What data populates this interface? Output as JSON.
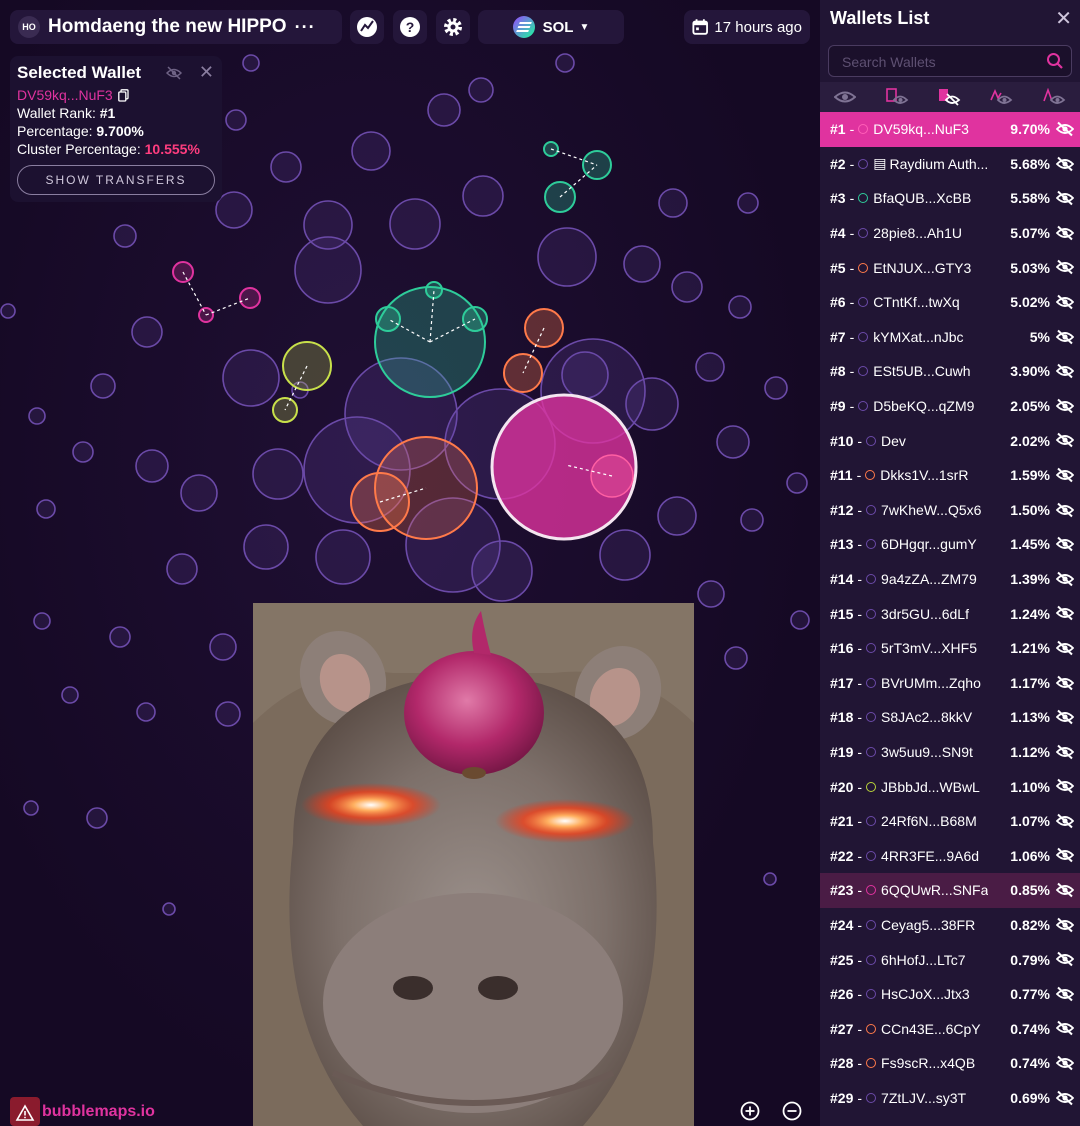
{
  "header": {
    "token_badge": "HO",
    "token_name": "Homdaeng the new HIPPO",
    "token_more": "···",
    "chain": "SOL",
    "time_label": "17 hours ago"
  },
  "icons": {
    "analytics": "analytics-icon",
    "help": "help-icon",
    "settings": "gear-icon",
    "calendar": "calendar-icon"
  },
  "selected_wallet": {
    "title": "Selected Wallet",
    "address": "DV59kq...NuF3",
    "rank_label": "Wallet Rank:",
    "rank_value": "#1",
    "pct_label": "Percentage:",
    "pct_value": "9.700%",
    "cluster_label": "Cluster Percentage:",
    "cluster_value": "10.555%",
    "transfers_button": "SHOW TRANSFERS"
  },
  "logo": {
    "text": "bubblemaps.io"
  },
  "panel": {
    "title": "Wallets List",
    "search_placeholder": "Search Wallets",
    "rows": [
      {
        "rank": "#1",
        "addr": "DV59kq...NuF3",
        "pct": "9.70%",
        "color": "#e0339f",
        "state": "sel"
      },
      {
        "rank": "#2",
        "addr": "Raydium Auth...",
        "pct": "5.68%",
        "color": "#6b4aa8",
        "doc": "▤"
      },
      {
        "rank": "#3",
        "addr": "BfaQUB...XcBB",
        "pct": "5.58%",
        "color": "#2ecc9a"
      },
      {
        "rank": "#4",
        "addr": "28pie8...Ah1U",
        "pct": "5.07%",
        "color": "#6b4aa8"
      },
      {
        "rank": "#5",
        "addr": "EtNJUX...GTY3",
        "pct": "5.03%",
        "color": "#ff7a4a"
      },
      {
        "rank": "#6",
        "addr": "CTntKf...twXq",
        "pct": "5.02%",
        "color": "#6b4aa8"
      },
      {
        "rank": "#7",
        "addr": "kYMXat...nJbc",
        "pct": "5%",
        "color": "#6b4aa8"
      },
      {
        "rank": "#8",
        "addr": "ESt5UB...Cuwh",
        "pct": "3.90%",
        "color": "#6b4aa8"
      },
      {
        "rank": "#9",
        "addr": "D5beKQ...qZM9",
        "pct": "2.05%",
        "color": "#6b4aa8"
      },
      {
        "rank": "#10",
        "addr": "Dev",
        "pct": "2.02%",
        "color": "#6b4aa8"
      },
      {
        "rank": "#11",
        "addr": "Dkks1V...1srR",
        "pct": "1.59%",
        "color": "#ff7a4a"
      },
      {
        "rank": "#12",
        "addr": "7wKheW...Q5x6",
        "pct": "1.50%",
        "color": "#6b4aa8"
      },
      {
        "rank": "#13",
        "addr": "6DHgqr...gumY",
        "pct": "1.45%",
        "color": "#6b4aa8"
      },
      {
        "rank": "#14",
        "addr": "9a4zZA...ZM79",
        "pct": "1.39%",
        "color": "#6b4aa8"
      },
      {
        "rank": "#15",
        "addr": "3dr5GU...6dLf",
        "pct": "1.24%",
        "color": "#6b4aa8"
      },
      {
        "rank": "#16",
        "addr": "5rT3mV...XHF5",
        "pct": "1.21%",
        "color": "#6b4aa8"
      },
      {
        "rank": "#17",
        "addr": "BVrUMm...Zqho",
        "pct": "1.17%",
        "color": "#6b4aa8"
      },
      {
        "rank": "#18",
        "addr": "S8JAc2...8kkV",
        "pct": "1.13%",
        "color": "#6b4aa8"
      },
      {
        "rank": "#19",
        "addr": "3w5uu9...SN9t",
        "pct": "1.12%",
        "color": "#6b4aa8"
      },
      {
        "rank": "#20",
        "addr": "JBbbJd...WBwL",
        "pct": "1.10%",
        "color": "#b9d33a"
      },
      {
        "rank": "#21",
        "addr": "24Rf6N...B68M",
        "pct": "1.07%",
        "color": "#6b4aa8"
      },
      {
        "rank": "#22",
        "addr": "4RR3FE...9A6d",
        "pct": "1.06%",
        "color": "#6b4aa8"
      },
      {
        "rank": "#23",
        "addr": "6QQUwR...SNFa",
        "pct": "0.85%",
        "color": "#e0339f",
        "state": "hl"
      },
      {
        "rank": "#24",
        "addr": "Ceyag5...38FR",
        "pct": "0.82%",
        "color": "#6b4aa8"
      },
      {
        "rank": "#25",
        "addr": "6hHofJ...LTc7",
        "pct": "0.79%",
        "color": "#6b4aa8"
      },
      {
        "rank": "#26",
        "addr": "HsCJoX...Jtx3",
        "pct": "0.77%",
        "color": "#6b4aa8"
      },
      {
        "rank": "#27",
        "addr": "CCn43E...6CpY",
        "pct": "0.74%",
        "color": "#ff7a4a"
      },
      {
        "rank": "#28",
        "addr": "Fs9scR...x4QB",
        "pct": "0.74%",
        "color": "#ff7a4a"
      },
      {
        "rank": "#29",
        "addr": "7ZtLJV...sy3T",
        "pct": "0.69%",
        "color": "#6b4aa8"
      }
    ]
  },
  "bubble_colors": {
    "purple": "#6b4aa8",
    "pink": "#e0339f",
    "teal": "#2ecc9a",
    "orange": "#ff7a4a",
    "lime": "#c8e04a"
  }
}
